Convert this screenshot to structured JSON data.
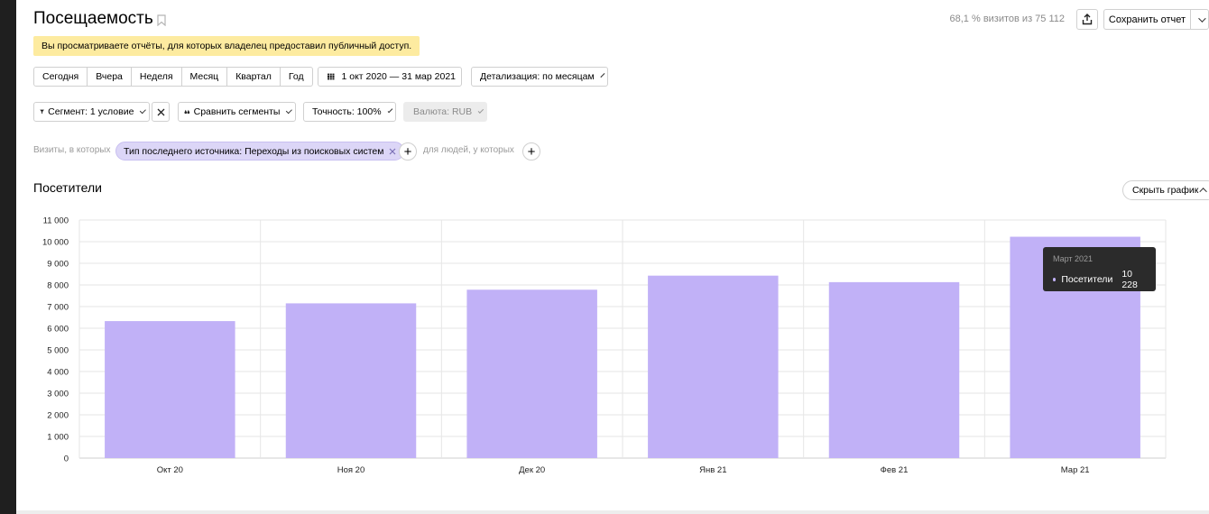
{
  "header": {
    "title": "Посещаемость",
    "visits_info": "68,1 % визитов из 75 112",
    "save_label": "Сохранить отчет"
  },
  "notice": "Вы просматриваете отчёты, для которых владелец предоставил публичный доступ.",
  "periods": [
    "Сегодня",
    "Вчера",
    "Неделя",
    "Месяц",
    "Квартал",
    "Год"
  ],
  "date_range": "1 окт 2020 — 31 мар 2021",
  "detail": "Детализация: по месяцам",
  "controls": {
    "segment": "Сегмент: 1 условие",
    "compare": "Сравнить сегменты",
    "accuracy": "Точность: 100%",
    "currency": "Валюта: RUB"
  },
  "filter": {
    "visits_label": "Визиты, в которых",
    "chip": "Тип последнего источника: Переходы из поисковых систем",
    "people_label": "для людей, у которых"
  },
  "section_title": "Посетители",
  "hide_chart": "Скрыть график",
  "tooltip": {
    "title": "Март 2021",
    "series": "Посетители",
    "value": "10 228"
  },
  "chart_data": {
    "type": "bar",
    "categories": [
      "Окт 20",
      "Ноя 20",
      "Дек 20",
      "Янв 21",
      "Фев 21",
      "Мар 21"
    ],
    "series": [
      {
        "name": "Посетители",
        "values": [
          6330,
          7150,
          7780,
          8430,
          8130,
          10228
        ]
      }
    ],
    "ylim": [
      0,
      11000
    ],
    "yticks": [
      0,
      1000,
      2000,
      3000,
      4000,
      5000,
      6000,
      7000,
      8000,
      9000,
      10000,
      11000
    ],
    "ytick_labels": [
      "0",
      "1 000",
      "2 000",
      "3 000",
      "4 000",
      "5 000",
      "6 000",
      "7 000",
      "8 000",
      "9 000",
      "10 000",
      "11 000"
    ],
    "grid": true,
    "bar_color": "#c1b1f7"
  }
}
